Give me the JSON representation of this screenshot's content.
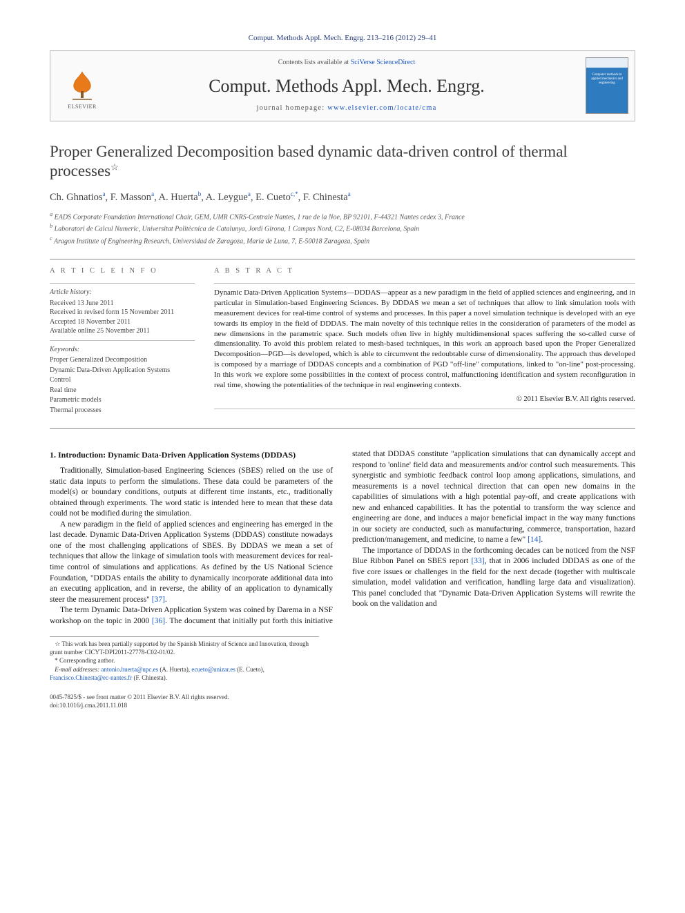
{
  "citation": "Comput. Methods Appl. Mech. Engrg. 213–216 (2012) 29–41",
  "header": {
    "contents_prefix": "Contents lists available at ",
    "contents_link": "SciVerse ScienceDirect",
    "journal": "Comput. Methods Appl. Mech. Engrg.",
    "homepage_prefix": "journal homepage: ",
    "homepage_link": "www.elsevier.com/locate/cma",
    "publisher": "ELSEVIER",
    "cover_text": "Computer methods in applied mechanics and engineering"
  },
  "title": "Proper Generalized Decomposition based dynamic data-driven control of thermal processes",
  "title_note_marker": "☆",
  "authors_line": {
    "a1": "Ch. Ghnatios",
    "a1_aff": "a",
    "a2": "F. Masson",
    "a2_aff": "a",
    "a3": "A. Huerta",
    "a3_aff": "b",
    "a4": "A. Leygue",
    "a4_aff": "a",
    "a5": "E. Cueto",
    "a5_aff": "c,",
    "a5_corr": "*",
    "a6": "F. Chinesta",
    "a6_aff": "a"
  },
  "affiliations": {
    "a": "EADS Corporate Foundation International Chair, GEM, UMR CNRS-Centrale Nantes, 1 rue de la Noe, BP 92101, F-44321 Nantes cedex 3, France",
    "b": "Laboratori de Calcul Numeric, Universitat Politècnica de Catalunya, Jordi Girona, 1 Campus Nord, C2, E-08034 Barcelona, Spain",
    "c": "Aragon Institute of Engineering Research, Universidad de Zaragoza, María de Luna, 7, E-50018 Zaragoza, Spain"
  },
  "article_info": {
    "heading": "A R T I C L E   I N F O",
    "history_label": "Article history:",
    "received": "Received 13 June 2011",
    "revised": "Received in revised form 15 November 2011",
    "accepted": "Accepted 18 November 2011",
    "online": "Available online 25 November 2011",
    "keywords_label": "Keywords:",
    "keywords": [
      "Proper Generalized Decomposition",
      "Dynamic Data-Driven Application Systems",
      "Control",
      "Real time",
      "Parametric models",
      "Thermal processes"
    ]
  },
  "abstract": {
    "heading": "A B S T R A C T",
    "text": "Dynamic Data-Driven Application Systems—DDDAS—appear as a new paradigm in the field of applied sciences and engineering, and in particular in Simulation-based Engineering Sciences. By DDDAS we mean a set of techniques that allow to link simulation tools with measurement devices for real-time control of systems and processes. In this paper a novel simulation technique is developed with an eye towards its employ in the field of DDDAS. The main novelty of this technique relies in the consideration of parameters of the model as new dimensions in the parametric space. Such models often live in highly multidimensional spaces suffering the so-called curse of dimensionality. To avoid this problem related to mesh-based techniques, in this work an approach based upon the Proper Generalized Decomposition—PGD—is developed, which is able to circumvent the redoubtable curse of dimensionality. The approach thus developed is composed by a marriage of DDDAS concepts and a combination of PGD \"off-line\" computations, linked to \"on-line\" post-processing. In this work we explore some possibilities in the context of process control, malfunctioning identification and system reconfiguration in real time, showing the potentialities of the technique in real engineering contexts.",
    "copyright": "© 2011 Elsevier B.V. All rights reserved."
  },
  "body": {
    "section1_title": "1. Introduction: Dynamic Data-Driven Application Systems (DDDAS)",
    "p1": "Traditionally, Simulation-based Engineering Sciences (SBES) relied on the use of static data inputs to perform the simulations. These data could be parameters of the model(s) or boundary conditions, outputs at different time instants, etc., traditionally obtained through experiments. The word static is intended here to mean that these data could not be modified during the simulation.",
    "p2": "A new paradigm in the field of applied sciences and engineering has emerged in the last decade. Dynamic Data-Driven Application Systems (DDDAS) constitute nowadays one of the most challenging applications of SBES. By DDDAS we mean a set of techniques that allow the linkage of simulation tools with measurement devices for real-time control of simulations and applications. As defined by the US National Science Foundation, \"DDDAS entails the ability to dynamically incorporate additional data into an executing application, and in reverse, the ability of an application to dynamically steer the measurement process\" ",
    "p2_ref": "[37]",
    "p2_tail": ".",
    "p3a": "The term Dynamic Data-Driven Application System was coined by Darema in a NSF workshop on the topic in 2000 ",
    "p3_ref1": "[36]",
    "p3b": ". The document that initially put forth this initiative stated that DDDAS constitute \"application simulations that can dynamically accept and respond to 'online' field data and measurements and/or control such measurements. This synergistic and symbiotic feedback control loop among applications, simulations, and measurements is a novel technical direction that can open new domains in the capabilities of simulations with a high potential pay-off, and create applications with new and enhanced capabilities. It has the potential to transform the way science and engineering are done, and induces a major beneficial impact in the way many functions in our society are conducted, such as manufacturing, commerce, transportation, hazard prediction/management, and medicine, to name a few\" ",
    "p3_ref2": "[14]",
    "p3c": ".",
    "p4a": "The importance of DDDAS in the forthcoming decades can be noticed from the NSF Blue Ribbon Panel on SBES report ",
    "p4_ref": "[33]",
    "p4b": ", that in 2006 included DDDAS as one of the five core issues or challenges in the field for the next decade (together with multiscale simulation, model validation and verification, handling large data and visualization). This panel concluded that \"Dynamic Data-Driven Application Systems will rewrite the book on the validation and"
  },
  "footnotes": {
    "funding_marker": "☆",
    "funding": "This work has been partially supported by the Spanish Ministry of Science and Innovation, through grant number CICYT-DPI2011-27778-C02-01/02.",
    "corr_marker": "*",
    "corr": "Corresponding author.",
    "email_label": "E-mail addresses:",
    "emails": [
      {
        "addr": "antonio.huerta@upc.es",
        "who": "(A. Huerta)"
      },
      {
        "addr": "ecueto@unizar.es",
        "who": "(E. Cueto)"
      },
      {
        "addr": "Francisco.Chinesta@ec-nantes.fr",
        "who": "(F. Chinesta)."
      }
    ]
  },
  "bottom": {
    "line1": "0045-7825/$ - see front matter © 2011 Elsevier B.V. All rights reserved.",
    "doi": "doi:10.1016/j.cma.2011.11.018"
  }
}
